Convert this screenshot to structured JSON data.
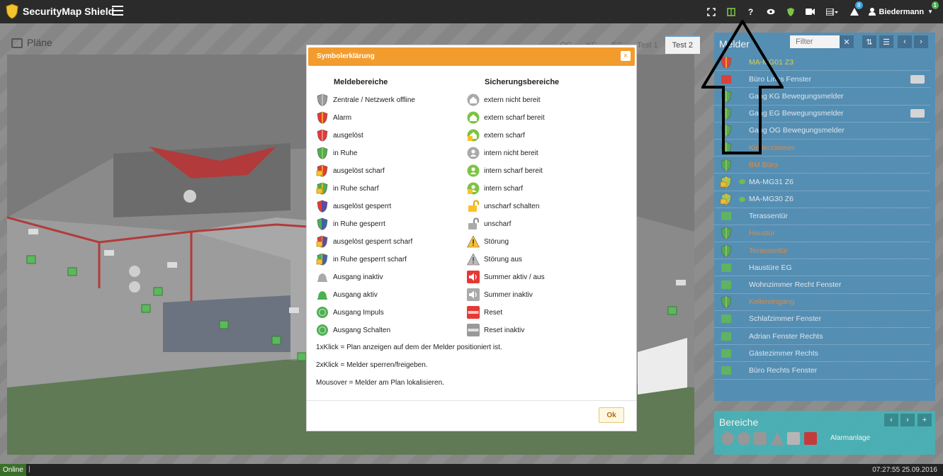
{
  "app": {
    "title": "SecurityMap Shield"
  },
  "topbar": {
    "alerts_badge": "8",
    "user_name": "Biedermann",
    "user_badge": "1"
  },
  "plans": {
    "title": "Pläne",
    "tabs": [
      "OG",
      "KG",
      "EG",
      "Test 1",
      "Test 2"
    ]
  },
  "melder": {
    "title": "Melder",
    "filter_placeholder": "Filter",
    "items": [
      {
        "label": "MA-MG01 Z3",
        "color": "yellow",
        "icon": "alarm-shield"
      },
      {
        "label": "Büro Links Fenster",
        "color": "white",
        "icon": "red-square"
      },
      {
        "label": "Gang KG Bewegungsmelder",
        "color": "white",
        "icon": "green-shield"
      },
      {
        "label": "Gang EG Bewegungsmelder",
        "color": "white",
        "icon": "green-shield"
      },
      {
        "label": "Gang OG Bewegungsmelder",
        "color": "white",
        "icon": "green-shield"
      },
      {
        "label": "Kinderzimmer",
        "color": "orange",
        "icon": "green-shield"
      },
      {
        "label": "BM Büro",
        "color": "orange",
        "icon": "green-shield"
      },
      {
        "label": "MA-MG31 Z6",
        "color": "white",
        "icon": "locked-shield"
      },
      {
        "label": "MA-MG30 Z6",
        "color": "white",
        "icon": "locked-shield"
      },
      {
        "label": "Terassentür",
        "color": "white",
        "icon": "green-square"
      },
      {
        "label": "Haustür",
        "color": "orange",
        "icon": "green-shield"
      },
      {
        "label": "Terassentür",
        "color": "orange",
        "icon": "green-shield"
      },
      {
        "label": "Haustüre EG",
        "color": "white",
        "icon": "green-square"
      },
      {
        "label": "Wohnzimmer Recht Fenster",
        "color": "white",
        "icon": "green-square"
      },
      {
        "label": "Kellereingang",
        "color": "orange",
        "icon": "green-shield"
      },
      {
        "label": "Schlafzimmer Fenster",
        "color": "white",
        "icon": "green-square"
      },
      {
        "label": "Adrian Fenster Rechts",
        "color": "white",
        "icon": "green-square"
      },
      {
        "label": "Gästezimmer Rechts",
        "color": "white",
        "icon": "green-square"
      },
      {
        "label": "Büro Rechts Fenster",
        "color": "white",
        "icon": "green-square"
      }
    ]
  },
  "bereiche": {
    "title": "Bereiche",
    "area_label": "Alarmanlage"
  },
  "footer": {
    "status": "Online",
    "separator": "|",
    "datetime": "07:27:55 25.09.2016"
  },
  "modal": {
    "title": "Symbolerklärung",
    "close": "×",
    "col1_heading": "Meldebereiche",
    "col2_heading": "Sicherungsbereiche",
    "col1": [
      {
        "label": "Zentrale / Netzwerk offline",
        "icon": "grey-shield"
      },
      {
        "label": "Alarm",
        "icon": "alarm-shield"
      },
      {
        "label": "ausgelöst",
        "icon": "red-shield"
      },
      {
        "label": "in Ruhe",
        "icon": "green-shield"
      },
      {
        "label": "ausgelöst scharf",
        "icon": "red-lock-shield"
      },
      {
        "label": "in Ruhe scharf",
        "icon": "green-lock-shield"
      },
      {
        "label": "ausgelöst gesperrt",
        "icon": "red-blue-shield"
      },
      {
        "label": "in Ruhe gesperrt",
        "icon": "green-blue-shield"
      },
      {
        "label": "ausgelöst gesperrt scharf",
        "icon": "red-blue-lock-shield"
      },
      {
        "label": "in Ruhe gesperrt scharf",
        "icon": "green-blue-lock-shield"
      },
      {
        "label": "Ausgang inaktiv",
        "icon": "grey-bell"
      },
      {
        "label": "Ausgang aktiv",
        "icon": "green-bell"
      },
      {
        "label": "Ausgang Impuls",
        "icon": "green-pulse"
      },
      {
        "label": "Ausgang Schalten",
        "icon": "green-power"
      }
    ],
    "col2": [
      {
        "label": "extern nicht bereit",
        "icon": "grey-house"
      },
      {
        "label": "extern scharf bereit",
        "icon": "green-house"
      },
      {
        "label": "extern scharf",
        "icon": "green-house-lock"
      },
      {
        "label": "intern nicht bereit",
        "icon": "grey-person"
      },
      {
        "label": "intern scharf bereit",
        "icon": "green-person"
      },
      {
        "label": "intern scharf",
        "icon": "green-person-lock"
      },
      {
        "label": "unscharf schalten",
        "icon": "gold-open-lock"
      },
      {
        "label": "unscharf",
        "icon": "grey-open-lock"
      },
      {
        "label": "Störung",
        "icon": "yellow-warning"
      },
      {
        "label": "Störung aus",
        "icon": "grey-warning"
      },
      {
        "label": "Summer aktiv / aus",
        "icon": "red-speaker"
      },
      {
        "label": "Summer inaktiv",
        "icon": "grey-speaker"
      },
      {
        "label": "Reset",
        "icon": "red-reset"
      },
      {
        "label": "Reset inaktiv",
        "icon": "grey-reset"
      }
    ],
    "notes": [
      "1xKlick = Plan anzeigen auf dem der Melder positioniert ist.",
      "2xKlick = Melder sperren/freigeben.",
      "Mousover = Melder am Plan lokalisieren."
    ],
    "ok_label": "Ok"
  },
  "colors": {
    "topbar": "#2b2b2b",
    "melder_panel": "#4f8fb8",
    "bereiche_panel": "#45b3b8",
    "modal_header": "#f39c2e",
    "ok_text": "#b06d10"
  }
}
